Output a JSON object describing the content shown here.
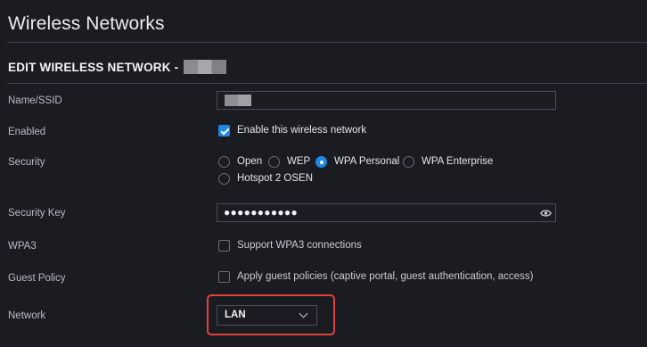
{
  "page": {
    "title": "Wireless Networks"
  },
  "section": {
    "title": "EDIT WIRELESS NETWORK -"
  },
  "fields": {
    "ssid": {
      "label": "Name/SSID"
    },
    "enabled": {
      "label": "Enabled",
      "checkbox_label": "Enable this wireless network",
      "checked": true
    },
    "security": {
      "label": "Security",
      "options": [
        "Open",
        "WEP",
        "WPA Personal",
        "WPA Enterprise",
        "Hotspot 2 OSEN"
      ],
      "selected": "WPA Personal"
    },
    "security_key": {
      "label": "Security Key",
      "masked_value": "●●●●●●●●●●●",
      "icon": "eye-icon"
    },
    "wpa3": {
      "label": "WPA3",
      "checkbox_label": "Support WPA3 connections",
      "checked": false
    },
    "guest_policy": {
      "label": "Guest Policy",
      "checkbox_label": "Apply guest policies (captive portal, guest authentication, access)",
      "checked": false
    },
    "network": {
      "label": "Network",
      "value": "LAN",
      "icon": "chevron-down-icon"
    }
  },
  "colors": {
    "accent": "#1e88e5",
    "highlight": "#e0413a",
    "background": "#1b1c22"
  }
}
